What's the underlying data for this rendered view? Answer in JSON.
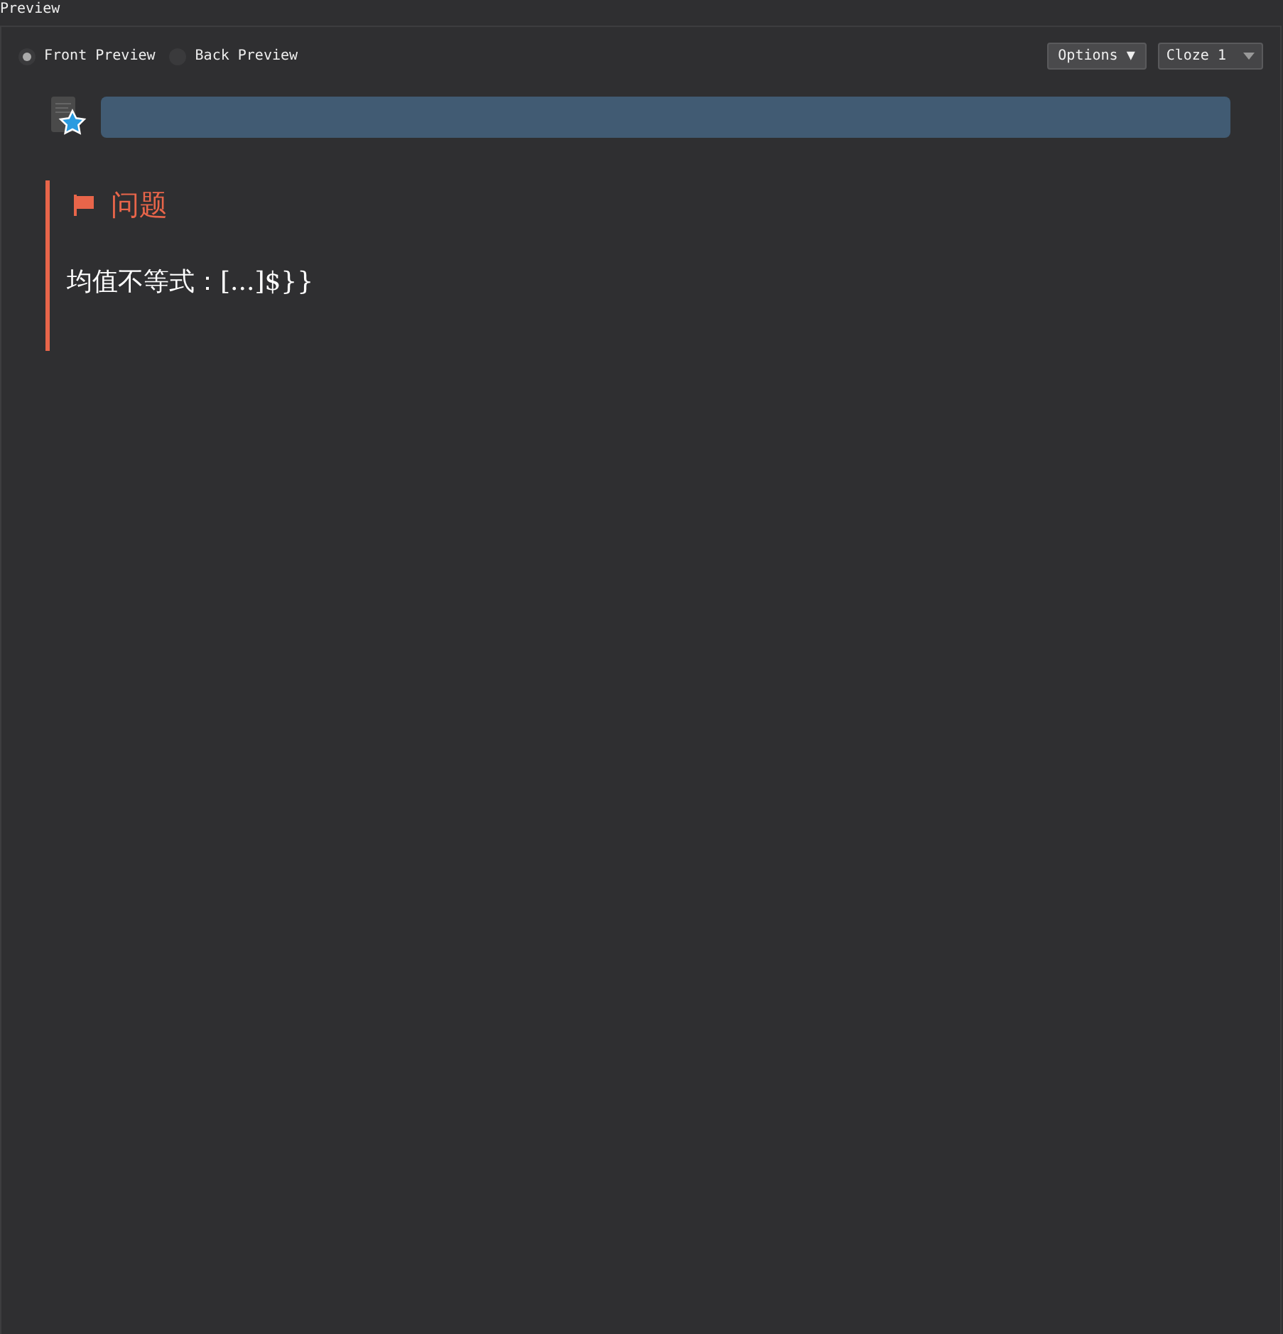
{
  "window": {
    "title": "Preview"
  },
  "preview_modes": [
    {
      "label": "Front Preview",
      "selected": true
    },
    {
      "label": "Back Preview",
      "selected": false
    }
  ],
  "options_button": {
    "label": "Options ▼"
  },
  "card_select": {
    "value": "Cloze 1"
  },
  "card": {
    "heading": "问题",
    "text": "均值不等式：[...]$}}"
  }
}
